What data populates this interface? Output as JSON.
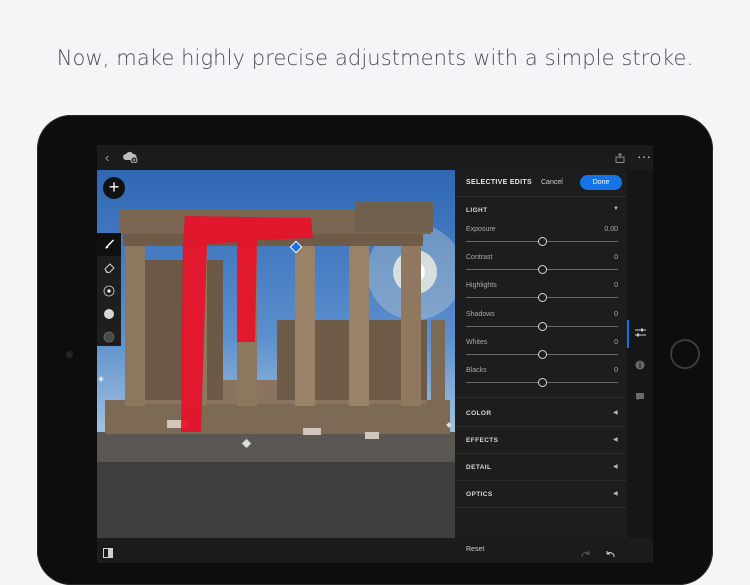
{
  "headline": "Now, make highly precise adjustments with a simple stroke.",
  "colors": {
    "accent": "#1473e6",
    "mask": "#e8102a",
    "panel_bg": "#1d1d1d"
  },
  "topbar": {
    "back_icon": "chevron-left-icon",
    "cloud_icon": "cloud-sync-icon",
    "share_icon": "share-icon",
    "more_icon": "more-icon"
  },
  "tools": {
    "add_icon": "plus-icon",
    "items": [
      "brush-icon",
      "eraser-icon",
      "brush-size-icon",
      "feather-icon",
      "flow-icon"
    ]
  },
  "panel": {
    "title": "SELECTIVE EDITS",
    "cancel_label": "Cancel",
    "done_label": "Done",
    "light_section": "LIGHT",
    "sliders": [
      {
        "label": "Exposure",
        "value": "0.00",
        "level": 0.5
      },
      {
        "label": "Contrast",
        "value": "0",
        "level": 0.5
      },
      {
        "label": "Highlights",
        "value": "0",
        "level": 0.5
      },
      {
        "label": "Shadows",
        "value": "0",
        "level": 0.5
      },
      {
        "label": "Whites",
        "value": "0",
        "level": 0.5
      },
      {
        "label": "Blacks",
        "value": "0",
        "level": 0.5
      }
    ],
    "sections": [
      "COLOR",
      "EFFECTS",
      "DETAIL",
      "OPTICS"
    ]
  },
  "side_icons": [
    "sliders-icon",
    "info-icon",
    "comment-icon"
  ],
  "bottombar": {
    "compare_icon": "compare-icon",
    "reset_label": "Reset",
    "redo_icon": "redo-icon",
    "undo_icon": "undo-icon"
  }
}
